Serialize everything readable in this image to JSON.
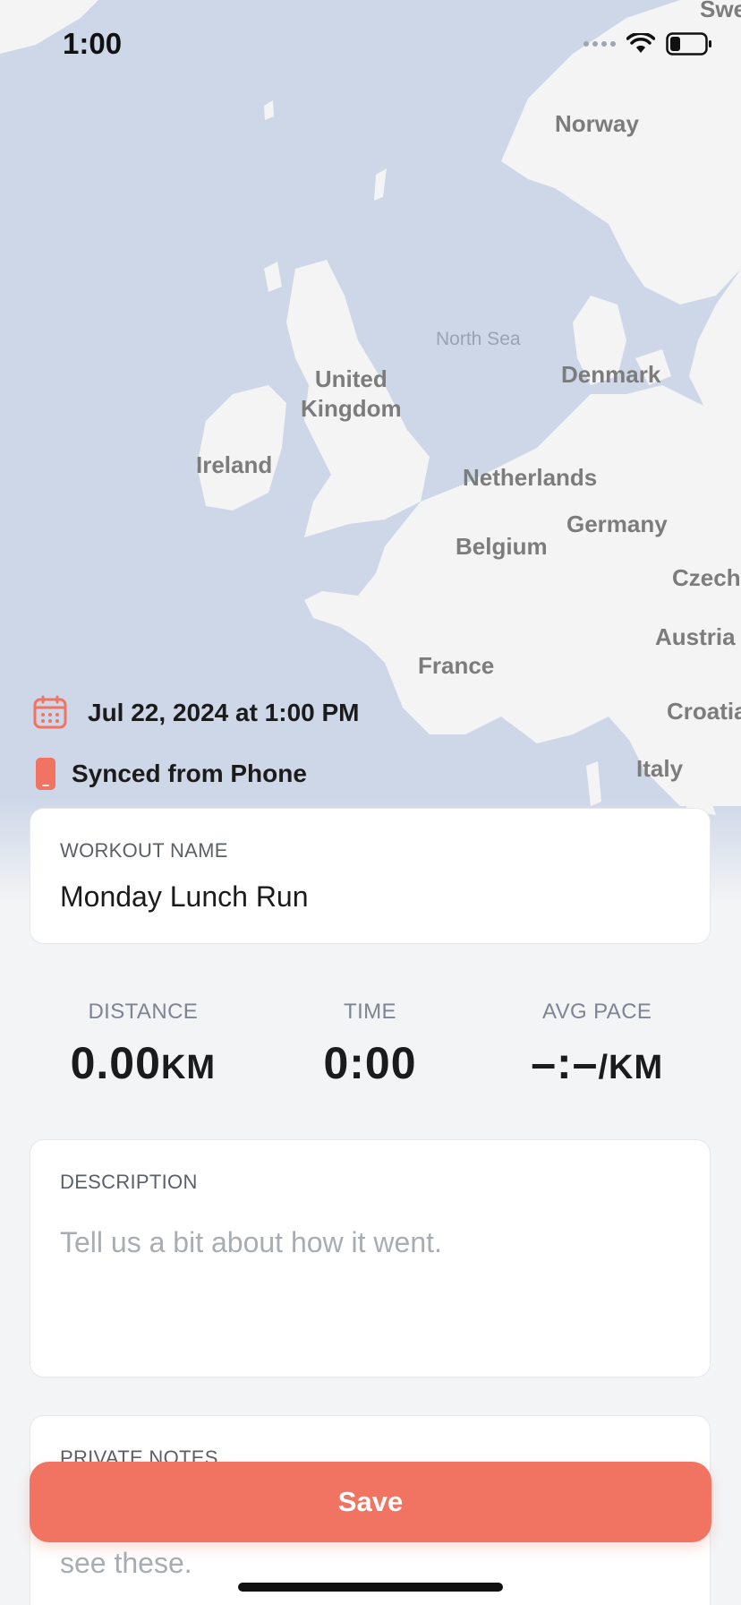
{
  "status_bar": {
    "time": "1:00"
  },
  "map": {
    "labels": {
      "sweden_partial": "Swe",
      "norway": "Norway",
      "north_sea": "North Sea",
      "denmark": "Denmark",
      "united_kingdom": "United\nKingdom",
      "ireland": "Ireland",
      "netherlands": "Netherlands",
      "germany": "Germany",
      "belgium": "Belgium",
      "czechia_partial": "Czech",
      "austria": "Austria",
      "france": "France",
      "croatia_partial": "Croatia",
      "italy": "Italy"
    },
    "colors": {
      "water": "#cdd7e8",
      "land": "#f4f4f4"
    }
  },
  "workout": {
    "date_text": "Jul 22, 2024 at 1:00 PM",
    "source_text": "Synced from Phone",
    "name_label": "WORKOUT NAME",
    "name_value": "Monday Lunch Run"
  },
  "stats": {
    "distance_label": "DISTANCE",
    "distance_value": "0.00",
    "distance_unit": "KM",
    "time_label": "TIME",
    "time_value": "0:00",
    "pace_label": "AVG PACE",
    "pace_value": "–:–",
    "pace_unit": "/KM"
  },
  "description": {
    "label": "DESCRIPTION",
    "placeholder": "Tell us a bit about how it went."
  },
  "private_notes": {
    "label": "PRIVATE NOTES",
    "placeholder_visible": "see these."
  },
  "actions": {
    "save_label": "Save"
  },
  "colors": {
    "accent": "#f07461",
    "background": "#f3f4f6"
  }
}
